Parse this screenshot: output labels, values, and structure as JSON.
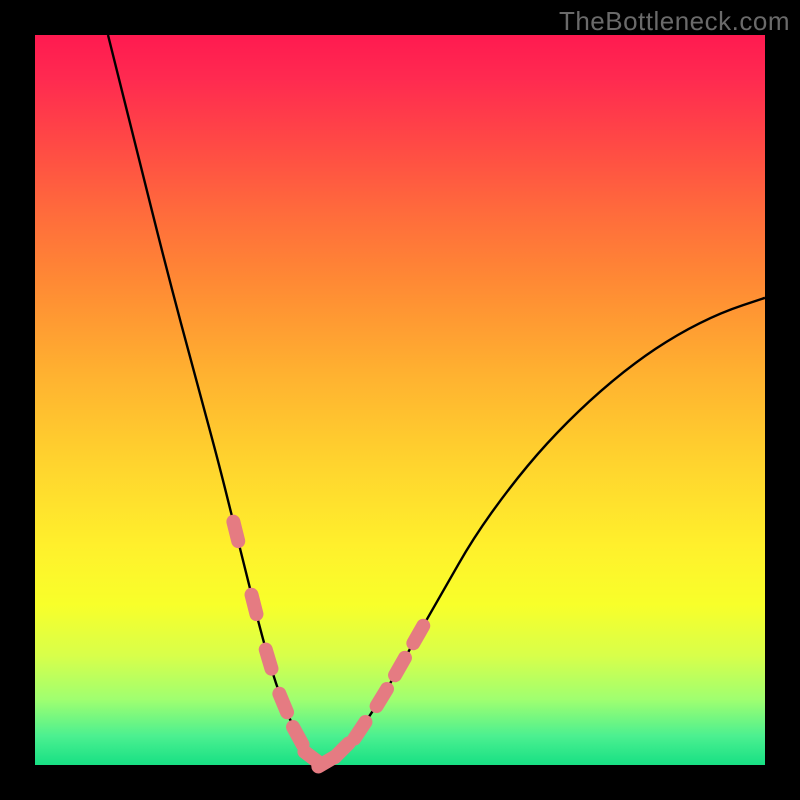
{
  "watermark": "TheBottleneck.com",
  "colors": {
    "page_bg": "#000000",
    "curve": "#000000",
    "marker": "#e57b82"
  },
  "chart_data": {
    "type": "line",
    "title": "",
    "xlabel": "",
    "ylabel": "",
    "xlim": [
      0,
      100
    ],
    "ylim": [
      0,
      100
    ],
    "grid": false,
    "legend": false,
    "note": "Values estimated from pixel positions; axes are unlabeled in the source image so x is normalized 0–100 and y is percent of plot height from bottom.",
    "series": [
      {
        "name": "curve",
        "x": [
          10,
          14,
          18,
          22,
          25,
          27,
          29,
          31,
          33,
          35,
          37,
          39,
          41,
          44,
          48,
          52,
          56,
          60,
          65,
          70,
          76,
          82,
          88,
          94,
          100
        ],
        "y": [
          100,
          84,
          68,
          53,
          42,
          34,
          26,
          18,
          11,
          6,
          2,
          0,
          1,
          4,
          10,
          17,
          24,
          31,
          38,
          44,
          50,
          55,
          59,
          62,
          64
        ]
      }
    ],
    "markers": {
      "note": "Salmon rounded dashes along the lower part of the curve (approximate x positions).",
      "x": [
        27.5,
        30,
        32,
        34,
        36,
        38,
        40,
        42,
        44.5,
        47.5,
        50,
        52.5
      ]
    }
  }
}
